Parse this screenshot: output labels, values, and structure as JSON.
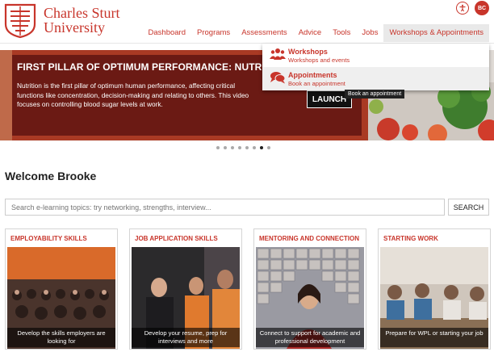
{
  "brand": {
    "line1": "Charles Sturt",
    "line2": "University",
    "color": "#c8352b"
  },
  "user": {
    "initials": "BC"
  },
  "nav": {
    "items": [
      "Dashboard",
      "Programs",
      "Assessments",
      "Advice",
      "Tools",
      "Jobs",
      "Workshops & Appointments"
    ]
  },
  "hero": {
    "title": "FIRST PILLAR OF OPTIMUM PERFORMANCE: NUTRITION",
    "body": "Nutrition is the first pillar of optimum human performance, affecting critical functions like concentration, decision-making and relating to others. This video focuses on controlling blood sugar levels at work.",
    "launch": "LAUNCH"
  },
  "dropdown": {
    "items": [
      {
        "title": "Workshops",
        "subtitle": "Workshops and events",
        "icon": "group-icon"
      },
      {
        "title": "Appointments",
        "subtitle": "Book an appointment",
        "icon": "chat-icon"
      }
    ],
    "tooltip": "Book an appointment"
  },
  "carousel": {
    "count": 8,
    "active_index": 6
  },
  "welcome": "Welcome Brooke",
  "search": {
    "placeholder": "Search e-learning topics: try networking, strengths, interview...",
    "button": "SEARCH"
  },
  "cards": [
    {
      "title": "EMPLOYABILITY SKILLS",
      "caption": "Develop the skills employers are looking for"
    },
    {
      "title": "JOB APPLICATION SKILLS",
      "caption": "Develop your resume, prep for interviews and more"
    },
    {
      "title": "MENTORING AND CONNECTION",
      "caption": "Connect to support for academic and professional development"
    },
    {
      "title": "STARTING WORK",
      "caption": "Prepare for WPL or starting your job"
    }
  ]
}
